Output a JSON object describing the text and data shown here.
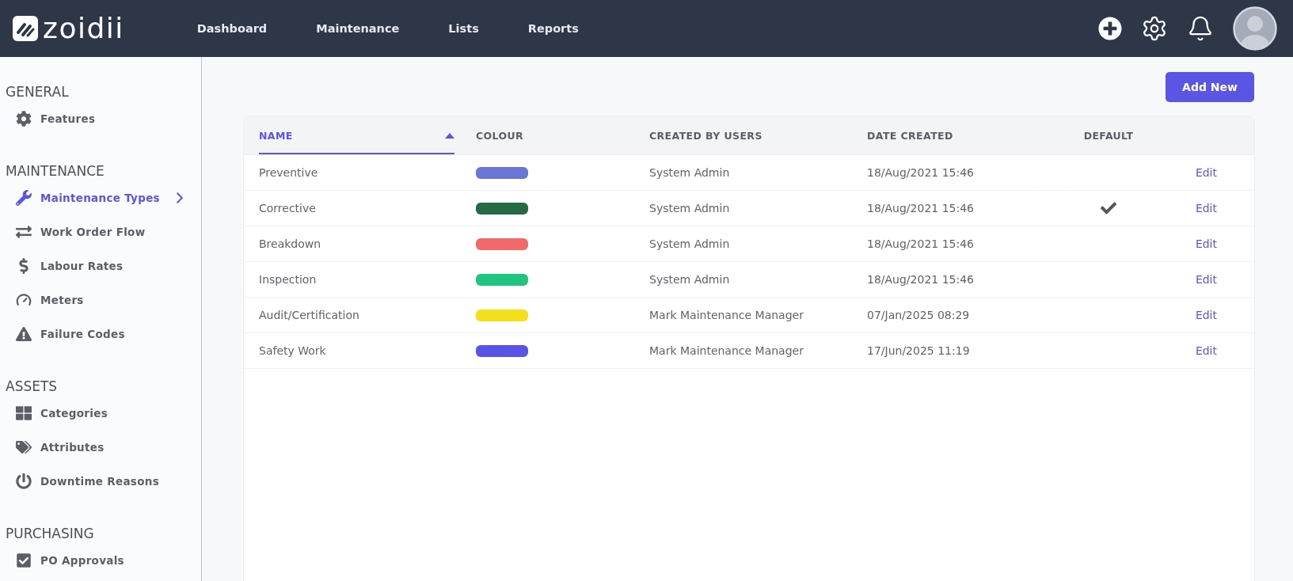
{
  "header": {
    "logo": "zoidii",
    "nav": [
      {
        "label": "Dashboard"
      },
      {
        "label": "Maintenance"
      },
      {
        "label": "Lists"
      },
      {
        "label": "Reports"
      }
    ]
  },
  "sidebar": {
    "sections": [
      {
        "heading": "GENERAL",
        "items": [
          {
            "label": "Features",
            "selected": false
          }
        ]
      },
      {
        "heading": "MAINTENANCE",
        "items": [
          {
            "label": "Maintenance Types",
            "selected": true
          },
          {
            "label": "Work Order Flow",
            "selected": false
          },
          {
            "label": "Labour Rates",
            "selected": false
          },
          {
            "label": "Meters",
            "selected": false
          },
          {
            "label": "Failure Codes",
            "selected": false
          }
        ]
      },
      {
        "heading": "ASSETS",
        "items": [
          {
            "label": "Categories",
            "selected": false
          },
          {
            "label": "Attributes",
            "selected": false
          },
          {
            "label": "Downtime Reasons",
            "selected": false
          }
        ]
      },
      {
        "heading": "PURCHASING",
        "items": [
          {
            "label": "PO Approvals",
            "selected": false
          }
        ]
      }
    ]
  },
  "toolbar": {
    "add_button": "Add New"
  },
  "table": {
    "columns": [
      {
        "label": "NAME",
        "sorted": true
      },
      {
        "label": "COLOUR",
        "sorted": false
      },
      {
        "label": "CREATED BY USERS",
        "sorted": false
      },
      {
        "label": "DATE CREATED",
        "sorted": false
      },
      {
        "label": "DEFAULT",
        "sorted": false
      }
    ],
    "rows": [
      {
        "name": "Preventive",
        "color": "#6a75d6",
        "created_by": "System Admin",
        "date_created": "18/Aug/2021 15:46",
        "default": false,
        "action": "Edit"
      },
      {
        "name": "Corrective",
        "color": "#246a45",
        "created_by": "System Admin",
        "date_created": "18/Aug/2021 15:46",
        "default": true,
        "action": "Edit"
      },
      {
        "name": "Breakdown",
        "color": "#f36868",
        "created_by": "System Admin",
        "date_created": "18/Aug/2021 15:46",
        "default": false,
        "action": "Edit"
      },
      {
        "name": "Inspection",
        "color": "#1fc47e",
        "created_by": "System Admin",
        "date_created": "18/Aug/2021 15:46",
        "default": false,
        "action": "Edit"
      },
      {
        "name": "Audit/Certification",
        "color": "#f3e01a",
        "created_by": "Mark Maintenance Manager",
        "date_created": "07/Jan/2025 08:29",
        "default": false,
        "action": "Edit"
      },
      {
        "name": "Safety Work",
        "color": "#5953e6",
        "created_by": "Mark Maintenance Manager",
        "date_created": "17/Jun/2025 11:19",
        "default": false,
        "action": "Edit"
      }
    ]
  }
}
